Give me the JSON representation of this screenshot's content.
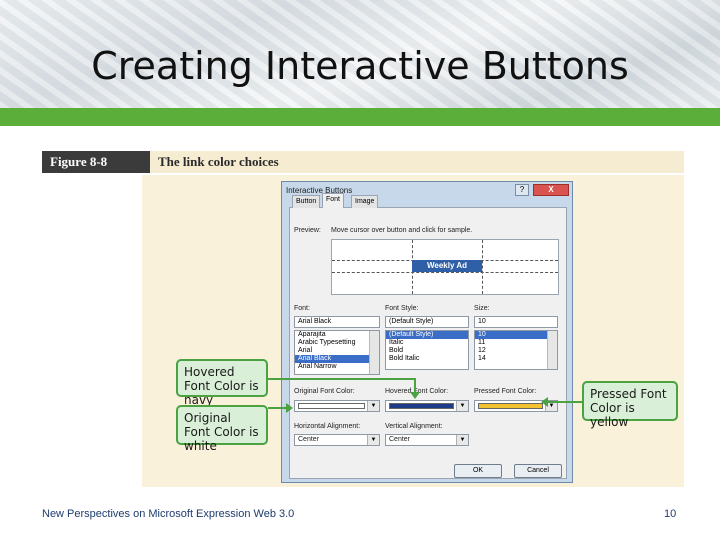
{
  "slide": {
    "title": "Creating Interactive Buttons",
    "footer_left": "New Perspectives on Microsoft Expression Web 3.0",
    "page_number": "10"
  },
  "figure": {
    "label": "Figure 8-8",
    "title": "The link color choices"
  },
  "dialog": {
    "title": "Interactive Buttons",
    "help_label": "?",
    "close_label": "X",
    "tabs": [
      "Button",
      "Font",
      "Image"
    ],
    "active_tab": "Font",
    "preview_label": "Preview:",
    "preview_hint": "Move cursor over button and click for sample.",
    "sample_button": "Weekly Ad",
    "font_label": "Font:",
    "font_value": "Arial Black",
    "font_list": [
      "Aparajita",
      "Arabic Typesetting",
      "Arial",
      "Arial Black",
      "Arial Narrow"
    ],
    "font_selected": "Arial Black",
    "style_label": "Font Style:",
    "style_value": "(Default Style)",
    "style_list": [
      "(Default Style)",
      "Italic",
      "Bold",
      "Bold Italic"
    ],
    "style_selected": "(Default Style)",
    "size_label": "Size:",
    "size_value": "10",
    "size_list": [
      "10",
      "11",
      "12",
      "14"
    ],
    "size_selected": "10",
    "original_color_label": "Original Font Color:",
    "hovered_color_label": "Hovered Font Color:",
    "pressed_color_label": "Pressed Font Color:",
    "colors": {
      "original": "#ffffff",
      "hovered": "#1f3c88",
      "pressed": "#f2c230"
    },
    "h_align_label": "Horizontal Alignment:",
    "h_align_value": "Center",
    "v_align_label": "Vertical Alignment:",
    "v_align_value": "Center",
    "ok_label": "OK",
    "cancel_label": "Cancel"
  },
  "callouts": {
    "hovered": "Hovered Font Color is navy",
    "original": "Original Font Color is white",
    "pressed": "Pressed Font Color is yellow"
  }
}
